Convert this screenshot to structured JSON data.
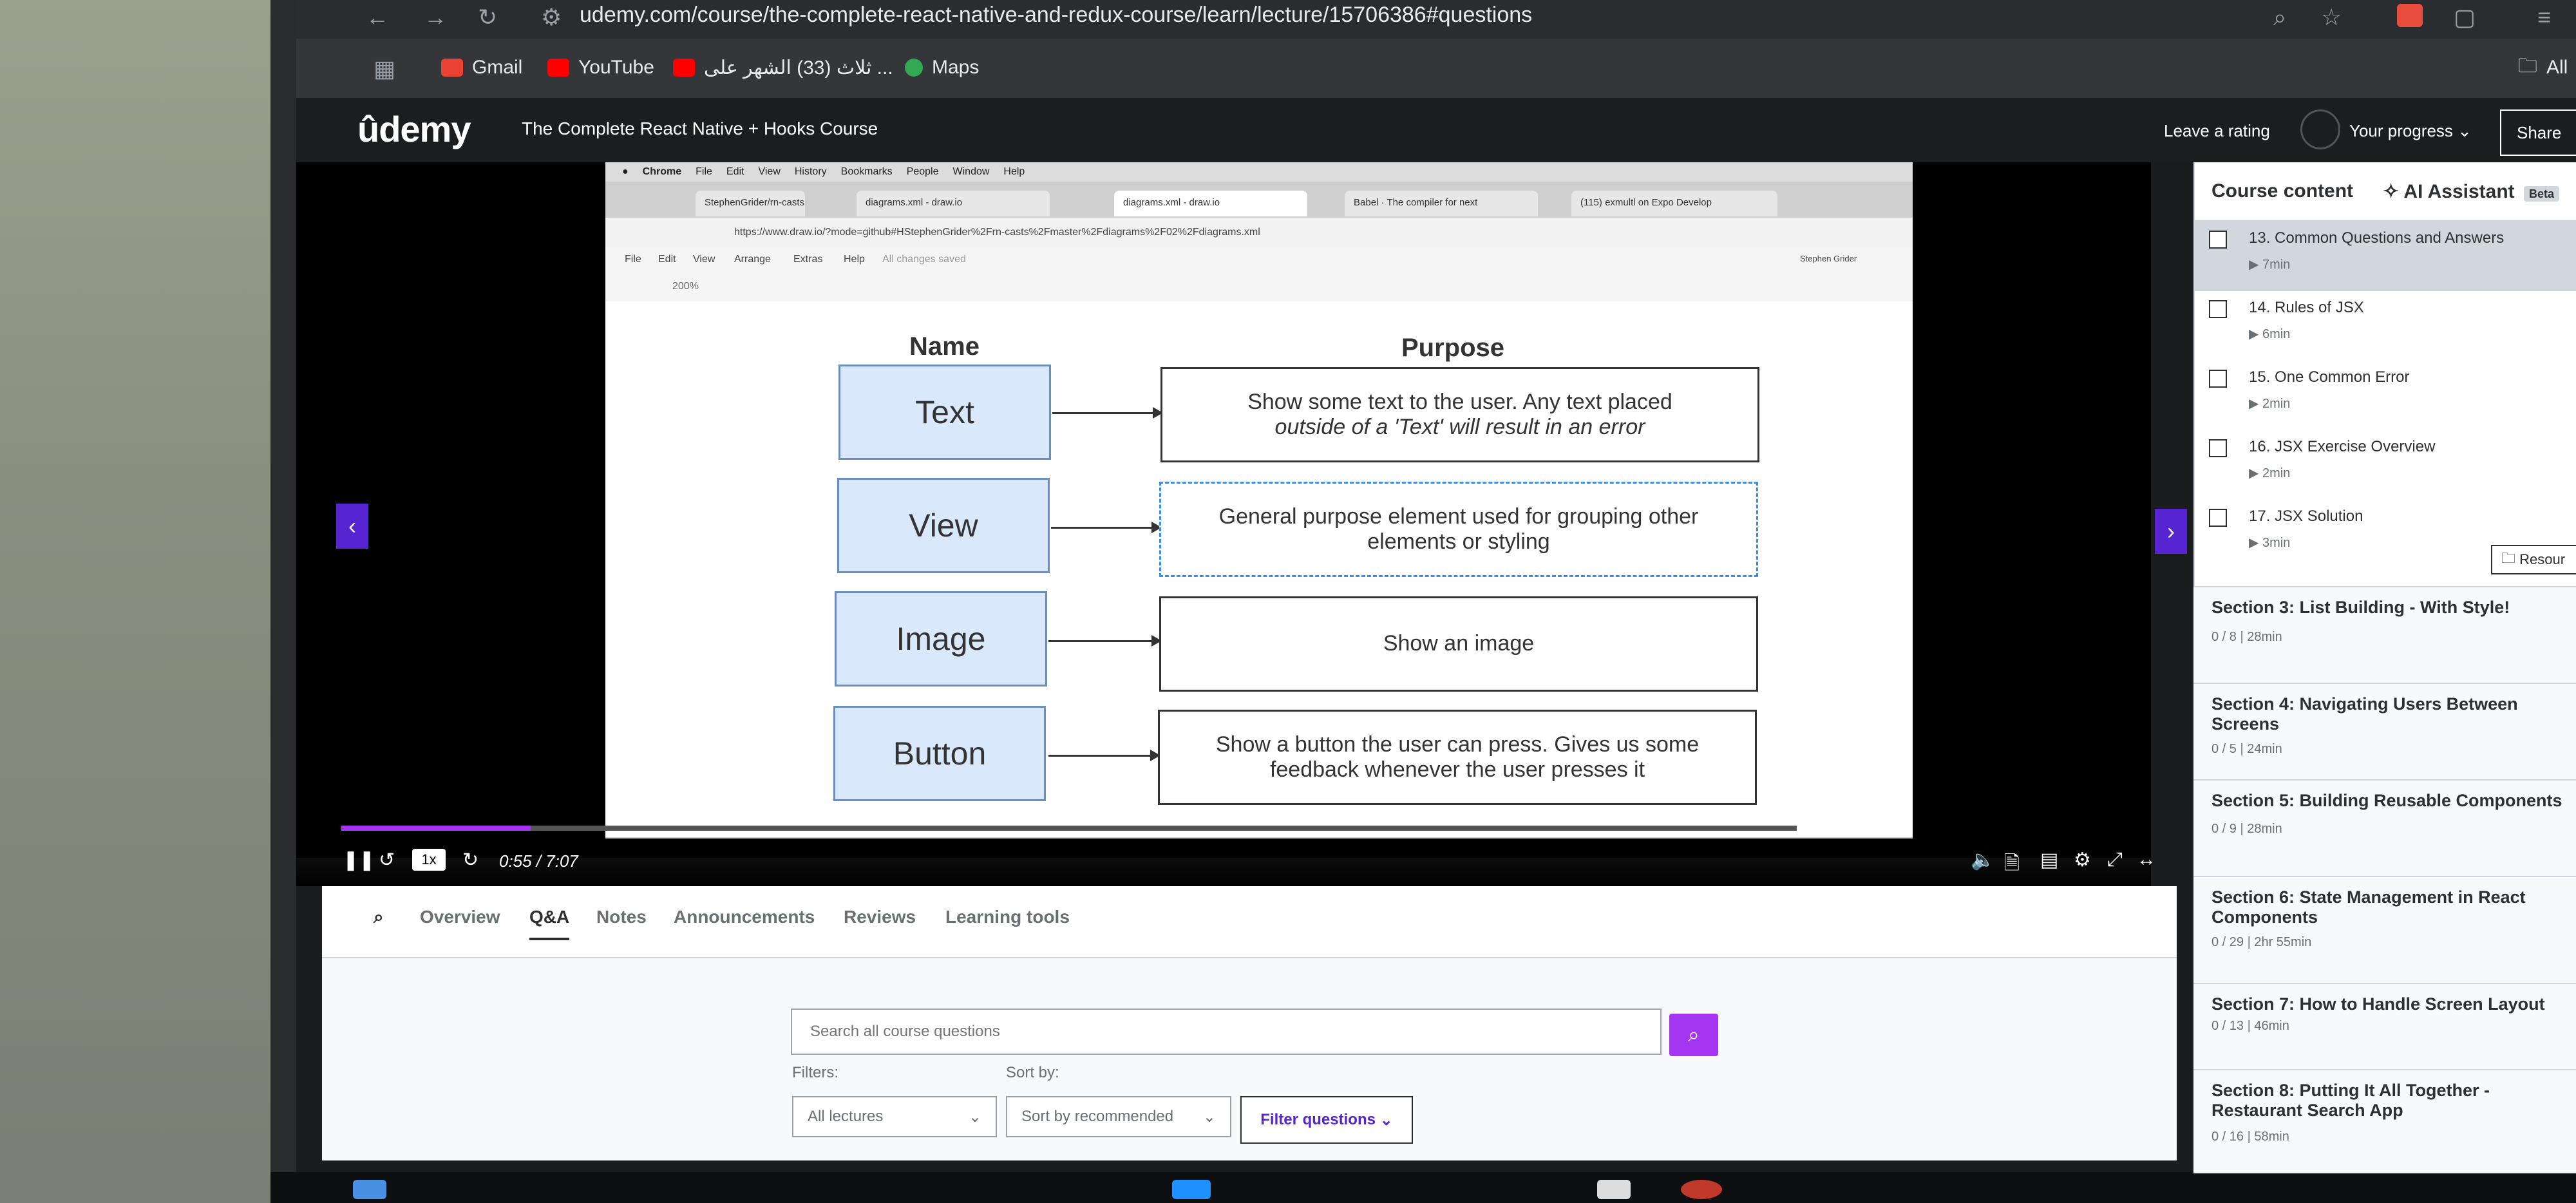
{
  "browser": {
    "url": "udemy.com/course/the-complete-react-native-and-redux-course/learn/lecture/15706386#questions",
    "bookmarks": [
      {
        "label": "Gmail",
        "icon": "gmail-icon",
        "color": "#ea4335"
      },
      {
        "label": "YouTube",
        "icon": "youtube-icon",
        "color": "#ff0000"
      },
      {
        "label": "ثلاث (33) الشهر على ...",
        "icon": "youtube-icon",
        "color": "#ff0000"
      },
      {
        "label": "Maps",
        "icon": "maps-icon",
        "color": "#34a853"
      }
    ],
    "all_bookmarks": "All"
  },
  "header": {
    "logo": "ûdemy",
    "course_title": "The Complete React Native + Hooks Course",
    "leave_rating": "Leave a rating",
    "your_progress": "Your progress",
    "share": "Share"
  },
  "video": {
    "mac_menu": [
      "Chrome",
      "File",
      "Edit",
      "View",
      "History",
      "Bookmarks",
      "People",
      "Window",
      "Help"
    ],
    "tabs": [
      "StephenGrider/rn-casts",
      "diagrams.xml - draw.io",
      "diagrams.xml - draw.io",
      "Babel · The compiler for next",
      "(115) exmultl on Expo Develop"
    ],
    "inner_url": "https://www.draw.io/?mode=github#HStephenGrider%2Frn-casts%2Fmaster%2Fdiagrams%2F02%2Fdiagrams.xml",
    "drawio_menu": [
      "File",
      "Edit",
      "View",
      "Arrange",
      "Extras",
      "Help",
      "All changes saved"
    ],
    "drawio_user": "Stephen Grider",
    "zoom": "200%",
    "diagram": {
      "name_header": "Name",
      "purpose_header": "Purpose",
      "rows": [
        {
          "name": "Text",
          "purpose_line1": "Show some text to the user. Any text placed",
          "purpose_line2": "outside of a 'Text' will result in an error"
        },
        {
          "name": "View",
          "purpose_line1": "General purpose element used for grouping other",
          "purpose_line2": "elements or styling"
        },
        {
          "name": "Image",
          "purpose_line1": "Show an image",
          "purpose_line2": ""
        },
        {
          "name": "Button",
          "purpose_line1": "Show a button the user can press. Gives us some",
          "purpose_line2": "feedback whenever the user presses it"
        }
      ]
    },
    "speed": "1x",
    "time": "0:55 / 7:07",
    "progress": 0.13
  },
  "tabs": [
    "Overview",
    "Q&A",
    "Notes",
    "Announcements",
    "Reviews",
    "Learning tools"
  ],
  "active_tab": "Q&A",
  "qa": {
    "search_placeholder": "Search all course questions",
    "filters_label": "Filters:",
    "sort_label": "Sort by:",
    "filter_select": "All lectures",
    "sort_select": "Sort by recommended",
    "filter_button": "Filter questions"
  },
  "sidebar": {
    "title": "Course content",
    "ai_assistant": "AI Assistant",
    "beta": "Beta",
    "lectures": [
      {
        "title": "13. Common Questions and Answers",
        "duration": "7min",
        "current": true
      },
      {
        "title": "14. Rules of JSX",
        "duration": "6min",
        "current": false
      },
      {
        "title": "15. One Common Error",
        "duration": "2min",
        "current": false
      },
      {
        "title": "16. JSX Exercise Overview",
        "duration": "2min",
        "current": false
      },
      {
        "title": "17. JSX Solution",
        "duration": "3min",
        "current": false
      }
    ],
    "resources": "Resour",
    "sections": [
      {
        "title": "Section 3: List Building - With Style!",
        "meta": "0 / 8 | 28min"
      },
      {
        "title": "Section 4: Navigating Users Between Screens",
        "meta": "0 / 5 | 24min"
      },
      {
        "title": "Section 5: Building Reusable Components",
        "meta": "0 / 9 | 28min"
      },
      {
        "title": "Section 6: State Management in React Components",
        "meta": "0 / 29 | 2hr 55min"
      },
      {
        "title": "Section 7: How to Handle Screen Layout",
        "meta": "0 / 13 | 46min"
      },
      {
        "title": "Section 8: Putting It All Together - Restaurant Search App",
        "meta": "0 / 16 | 58min"
      }
    ]
  }
}
